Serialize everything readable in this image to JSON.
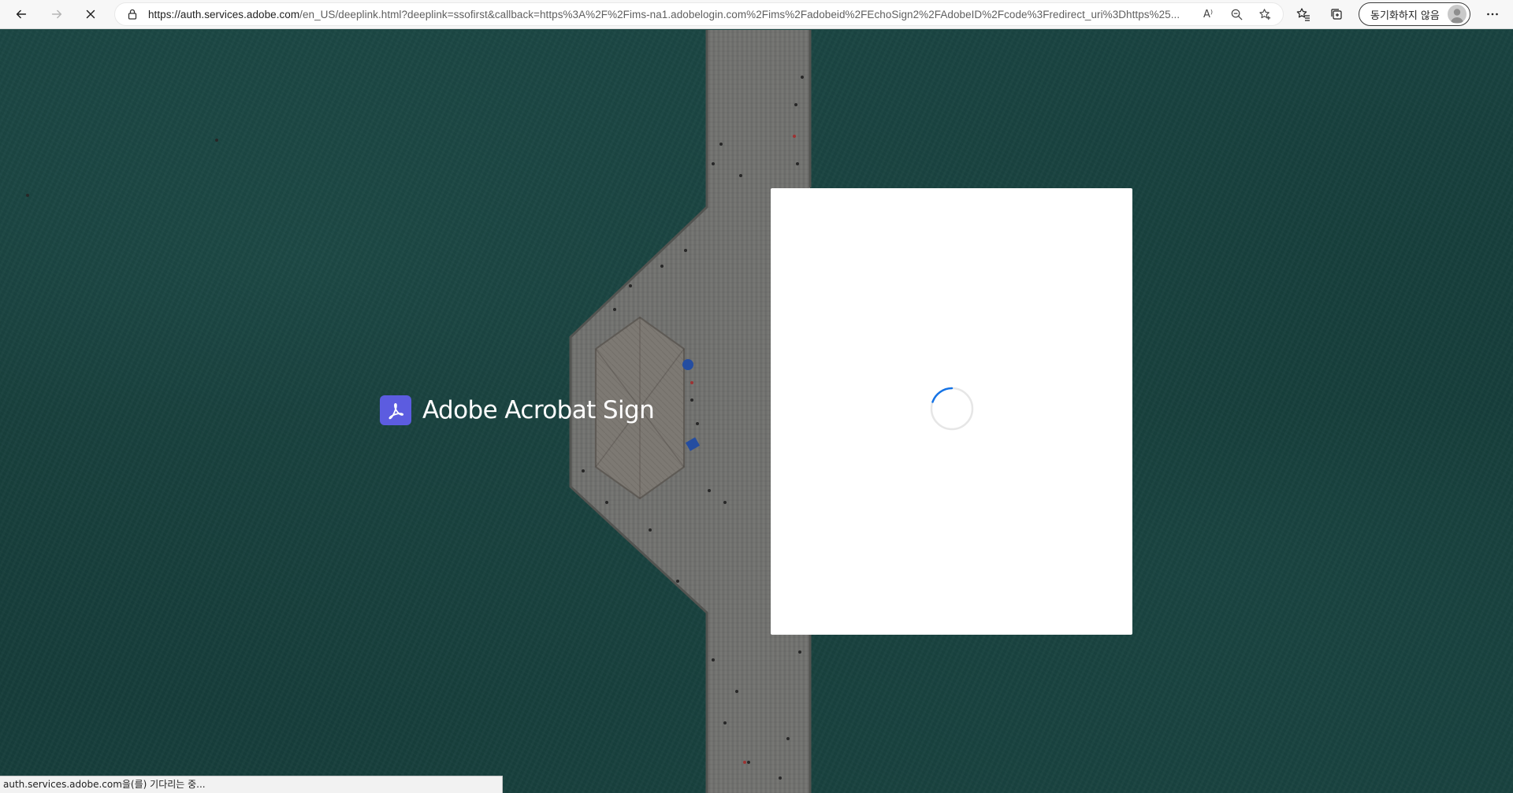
{
  "browser": {
    "url_host": "https://auth.services.adobe.com",
    "url_rest": "/en_US/deeplink.html?deeplink=ssofirst&callback=https%3A%2F%2Fims-na1.adobelogin.com%2Fims%2Fadobeid%2FEchoSign2%2FAdobeID%2Fcode%3Fredirect_uri%3Dhttps%25...",
    "read_aloud_label": "A⁾",
    "sync_button_label": "동기화하지 않음",
    "icons": {
      "back": "back-arrow-icon",
      "forward": "forward-arrow-icon",
      "stop": "stop-loading-icon",
      "lock": "lock-icon",
      "read_aloud": "read-aloud-icon",
      "zoom": "zoom-out-icon",
      "favorite": "add-favorite-icon",
      "favorites": "favorites-icon",
      "collections": "collections-icon",
      "more": "more-menu-icon"
    }
  },
  "page": {
    "brand_name": "Adobe Acrobat Sign",
    "brand_color": "#5c5ce0",
    "card_state": "loading",
    "spinner_color": "#1473e6"
  },
  "status_bar": {
    "text": "auth.services.adobe.com을(를) 기다리는 중..."
  }
}
